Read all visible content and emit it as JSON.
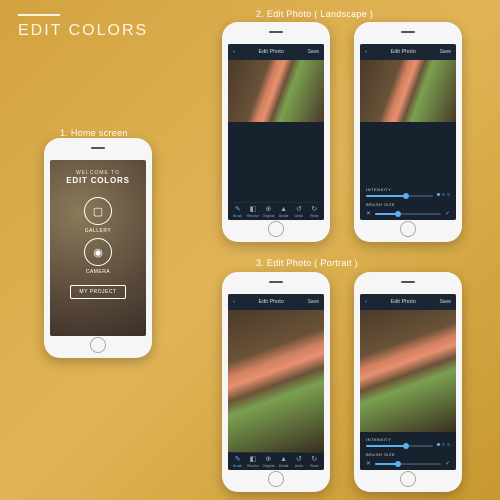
{
  "page_title": "EDIT COLORS",
  "captions": {
    "home": "1. Home screen",
    "landscape": "2. Edit Photo ( Landscape )",
    "portrait": "3. Edit Photo ( Portrait )"
  },
  "home": {
    "welcome": "WELCOME TO",
    "title": "EDIT COLORS",
    "gallery_label": "GALLERY",
    "camera_label": "CAMERA",
    "my_project": "MY PROJECT",
    "gallery_icon": "▢",
    "camera_icon": "◉"
  },
  "edit": {
    "back_icon": "‹",
    "title": "Edit Photo",
    "save": "Save",
    "intensity_label": "INTENSITY",
    "brush_label": "BRUSH SIZE",
    "intensity_pct": 60,
    "brush_pct": 35,
    "cancel_icon": "✕",
    "confirm_icon": "✓"
  },
  "tools": [
    {
      "icon": "✎",
      "label": "Brush"
    },
    {
      "icon": "◧",
      "label": "Recolor"
    },
    {
      "icon": "⊕",
      "label": "Original"
    },
    {
      "icon": "▲",
      "label": "Divide"
    },
    {
      "icon": "↺",
      "label": "Undo"
    },
    {
      "icon": "↻",
      "label": "Redo"
    }
  ]
}
